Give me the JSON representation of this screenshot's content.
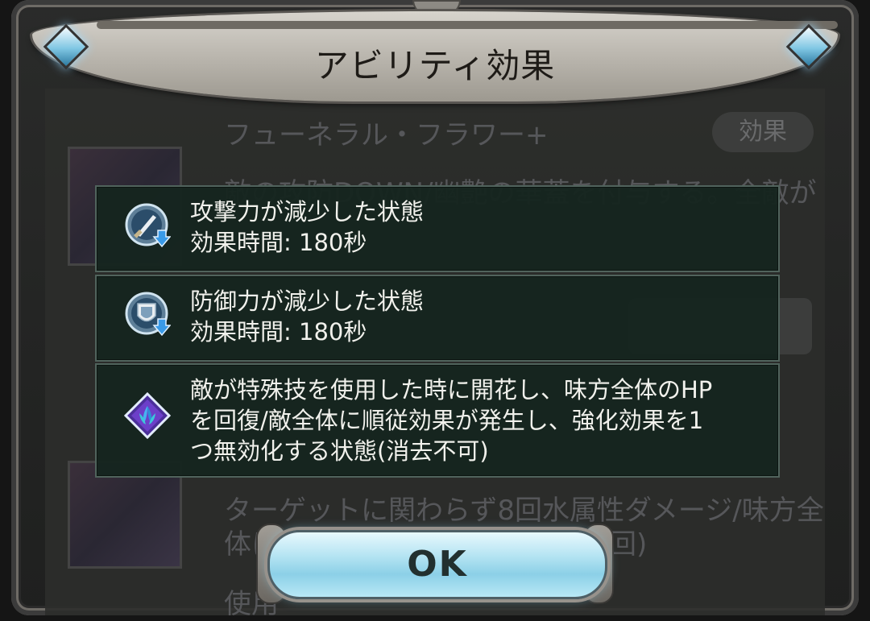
{
  "dialog": {
    "title": "アビリティ効果",
    "ok_label": "OK"
  },
  "effects": [
    {
      "icon": "attack-down-icon",
      "lines": [
        "攻撃力が減少した状態",
        "効果時間: 180秒"
      ]
    },
    {
      "icon": "defense-down-icon",
      "lines": [
        "防御力が減少した状態",
        "効果時間: 180秒"
      ]
    },
    {
      "icon": "blossom-icon",
      "lines": [
        "敵が特殊技を使用した時に開花し、味方全体のHP",
        "を回復/敵全体に順従効果が発生し、強化効果を1",
        "つ無効化する状態(消去不可)"
      ]
    }
  ],
  "background": {
    "skill_name": "フューネラル・フラワー+",
    "effect_chip": "効果",
    "line1": "敵の攻防DOWN/幽艶の華蓋を付与する。全敵が",
    "line2": "ターゲットに関わらず8回水属性ダメージ/味方全",
    "line3": "体に",
    "line3b": "回)",
    "use_label": "使用"
  },
  "colors": {
    "panel_bg": "#15251f",
    "panel_border": "#50635c",
    "ok_button": "#b7e5f3"
  }
}
